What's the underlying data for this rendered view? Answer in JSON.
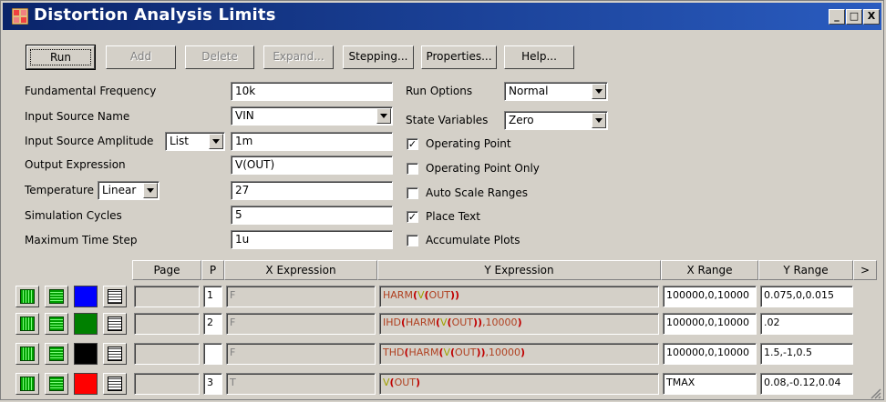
{
  "window": {
    "title": "Distortion Analysis Limits",
    "controls": [
      "_",
      "□",
      "X"
    ]
  },
  "toolbar": [
    {
      "label": "Run",
      "state": "default"
    },
    {
      "label": "Add",
      "state": "disabled"
    },
    {
      "label": "Delete",
      "state": "disabled"
    },
    {
      "label": "Expand...",
      "state": "disabled"
    },
    {
      "label": "Stepping...",
      "state": "enabled"
    },
    {
      "label": "Properties...",
      "state": "enabled"
    },
    {
      "label": "Help...",
      "state": "enabled"
    }
  ],
  "form": {
    "fundamental_frequency": {
      "label": "Fundamental Frequency",
      "value": "10k"
    },
    "input_source_name": {
      "label": "Input Source Name",
      "value": "VIN"
    },
    "input_source_amplitude": {
      "label": "Input Source Amplitude",
      "mode": "List",
      "value": "1m"
    },
    "output_expression": {
      "label": "Output Expression",
      "value": "V(OUT)"
    },
    "temperature": {
      "label": "Temperature",
      "mode": "Linear",
      "value": "27"
    },
    "simulation_cycles": {
      "label": "Simulation Cycles",
      "value": "5"
    },
    "maximum_time_step": {
      "label": "Maximum Time Step",
      "value": "1u"
    }
  },
  "options": {
    "run_options": {
      "label": "Run Options",
      "value": "Normal"
    },
    "state_variables": {
      "label": "State Variables",
      "value": "Zero"
    },
    "checkboxes": [
      {
        "label": "Operating Point",
        "checked": true
      },
      {
        "label": "Operating Point Only",
        "checked": false
      },
      {
        "label": "Auto Scale Ranges",
        "checked": false
      },
      {
        "label": "Place Text",
        "checked": true
      },
      {
        "label": "Accumulate Plots",
        "checked": false
      }
    ]
  },
  "table": {
    "headers": {
      "page": "Page",
      "p": "P",
      "x_expr": "X Expression",
      "y_expr": "Y Expression",
      "x_range": "X Range",
      "y_range": "Y Range",
      "more": ">"
    },
    "rows": [
      {
        "color": "#0000ff",
        "page": "",
        "p": "1",
        "x_expr": "F",
        "y_expr": "HARM(V(OUT))",
        "x_range": "100000,0,10000",
        "y_range": "0.075,0,0.015"
      },
      {
        "color": "#008000",
        "page": "",
        "p": "2",
        "x_expr": "F",
        "y_expr": "IHD(HARM(V(OUT)),10000)",
        "x_range": "100000,0,10000",
        "y_range": ".02"
      },
      {
        "color": "#000000",
        "page": "",
        "p": "",
        "x_expr": "F",
        "y_expr": "THD(HARM(V(OUT)),10000)",
        "x_range": "100000,0,10000",
        "y_range": "1.5,-1,0.5"
      },
      {
        "color": "#ff0000",
        "page": "",
        "p": "3",
        "x_expr": "T",
        "y_expr": "V(OUT)",
        "x_range": "TMAX",
        "y_range": "0.08,-0.12,0.04"
      }
    ]
  }
}
